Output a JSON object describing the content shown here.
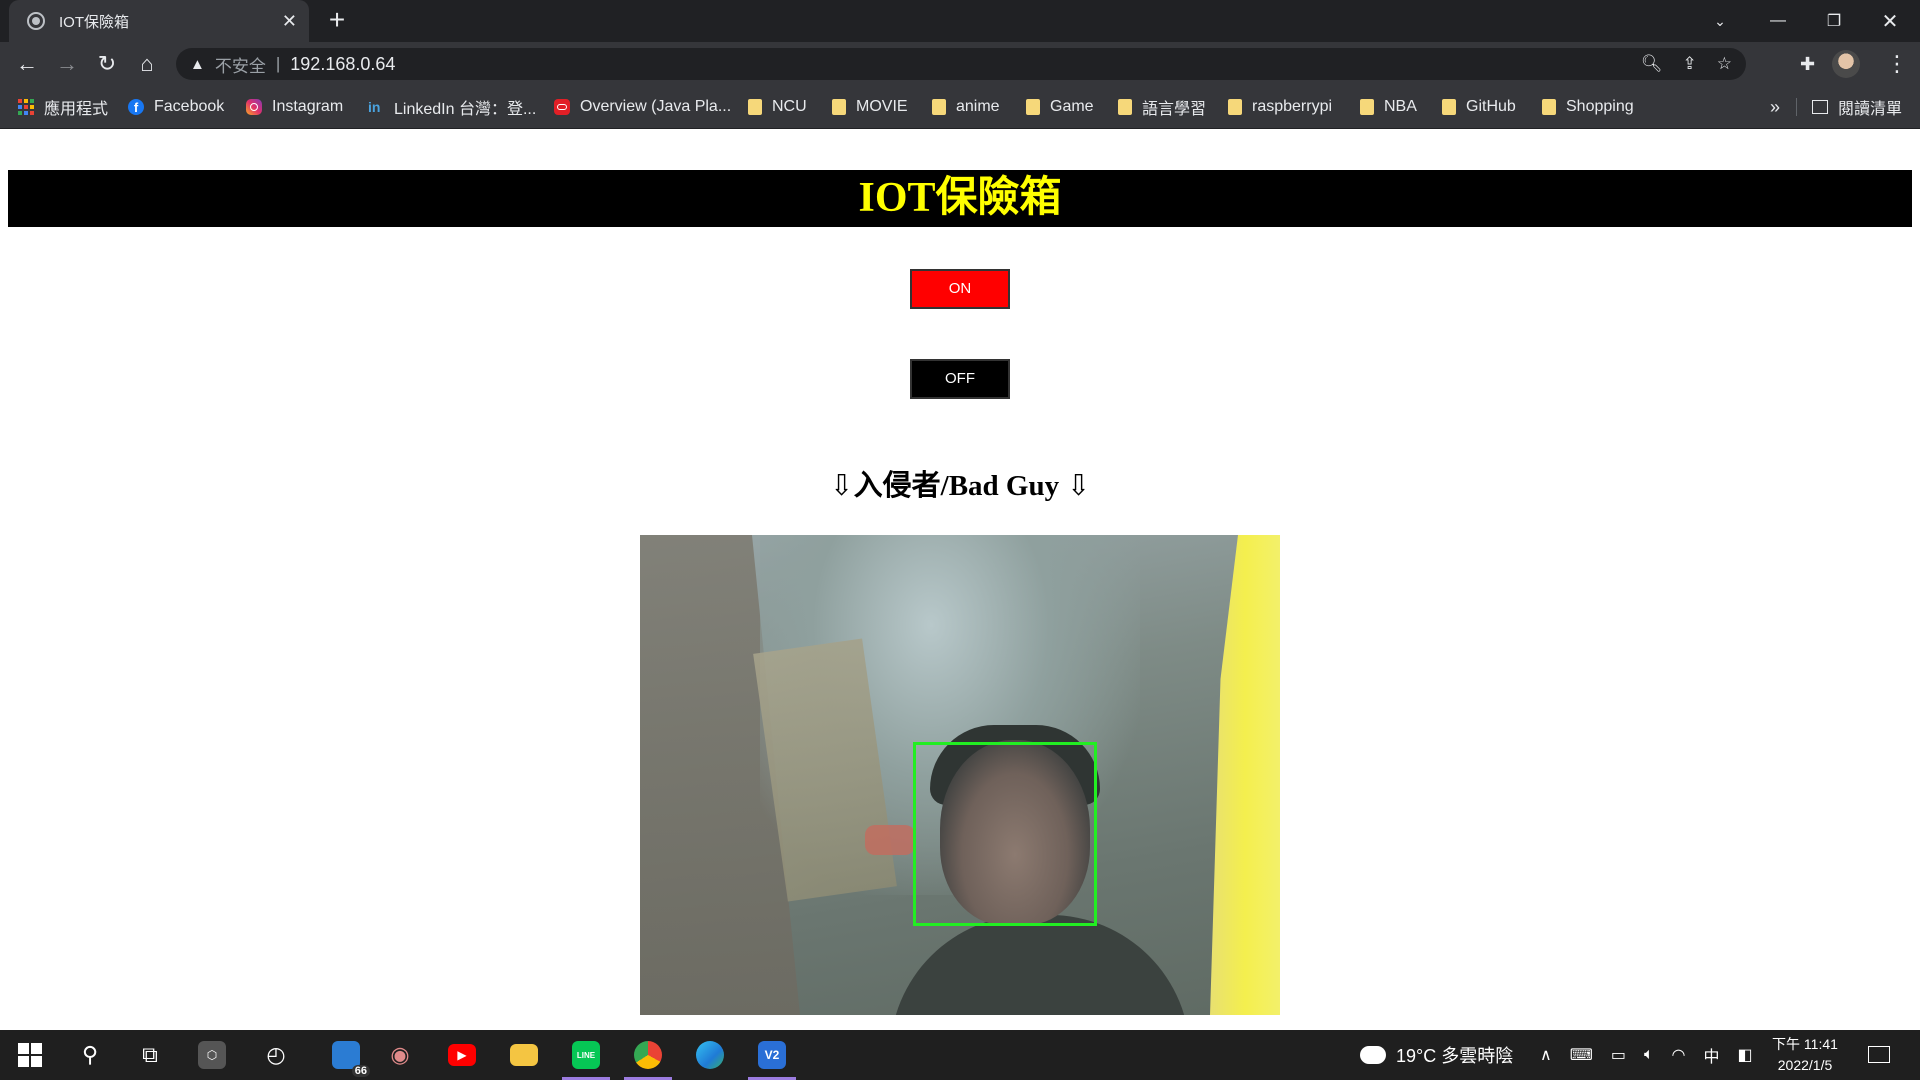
{
  "browser": {
    "tab_title": "IOT保險箱",
    "tab_close": "✕",
    "new_tab": "+",
    "security_label": "不安全",
    "url": "192.168.0.64",
    "bookmarks": [
      {
        "label": "應用程式",
        "icon": "apps-icon"
      },
      {
        "label": "Facebook",
        "icon": "facebook-icon"
      },
      {
        "label": "Instagram",
        "icon": "instagram-icon"
      },
      {
        "label": "LinkedIn 台灣：登...",
        "icon": "linkedin-icon"
      },
      {
        "label": "Overview (Java Pla...",
        "icon": "oracle-icon"
      },
      {
        "label": "NCU",
        "icon": "folder-icon"
      },
      {
        "label": "MOVIE",
        "icon": "folder-icon"
      },
      {
        "label": "anime",
        "icon": "folder-icon"
      },
      {
        "label": "Game",
        "icon": "folder-icon"
      },
      {
        "label": "語言學習",
        "icon": "folder-icon"
      },
      {
        "label": "raspberrypi",
        "icon": "folder-icon"
      },
      {
        "label": "NBA",
        "icon": "folder-icon"
      },
      {
        "label": "GitHub",
        "icon": "folder-icon"
      },
      {
        "label": "Shopping",
        "icon": "folder-icon"
      }
    ],
    "bookmarks_more": "»",
    "reading_list": "閱讀清單"
  },
  "page": {
    "title": "IOT保險箱",
    "on_label": "ON",
    "off_label": "OFF",
    "intruder_heading": "⇩入侵者/Bad Guy ⇩",
    "colors": {
      "header_bg": "#000000",
      "header_text": "#ffff00",
      "on_bg": "#ff0000",
      "off_bg": "#000000",
      "face_box": "#22ee22"
    }
  },
  "taskbar": {
    "explorer_badge": "66",
    "weather": "19°C  多雲時陰",
    "ime": "中",
    "time": "下午 11:41",
    "date": "2022/1/5"
  }
}
